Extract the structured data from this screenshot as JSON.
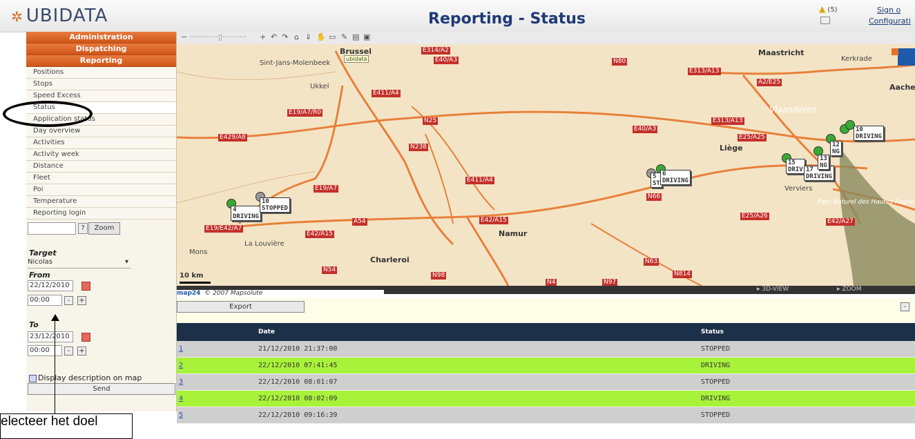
{
  "header": {
    "logo_text": "UBIDATA",
    "title": "Reporting - Status",
    "alert_count": "(5)",
    "sign_out": "Sign o",
    "configuration": "Configurati"
  },
  "sidebar": {
    "sections": [
      "Administration",
      "Dispatching",
      "Reporting"
    ],
    "items": [
      "Positions",
      "Stops",
      "Speed Excess",
      "Status",
      "Application status",
      "Day overview",
      "Activities",
      "Activity week",
      "Distance",
      "Fleet",
      "Poi",
      "Temperature",
      "Reporting login"
    ],
    "zoom_help": "?",
    "zoom_label": "Zoom",
    "target_label": "Target",
    "target_value": "Nicolas",
    "from_label": "From",
    "from_date": "22/12/2010",
    "from_time": "00:00",
    "to_label": "To",
    "to_date": "23/12/2010",
    "to_time": "00:00",
    "display_desc_label": "Display description on map",
    "send_label": "Send",
    "minus": "-",
    "plus": "+"
  },
  "map": {
    "places": [
      "Sint-Jans-Molenbeek",
      "Ukkel",
      "Maastricht",
      "Kerkrade",
      "Aachen",
      "Vlaanderen",
      "Liège",
      "Verviers",
      "Namur",
      "Charleroi",
      "La Louvière",
      "Mons",
      "Parc Naturel des Hautes Fagnes",
      "Brussel",
      "ubidata"
    ],
    "roads": [
      "E314/A2",
      "E40/A3",
      "N80",
      "E313/A13",
      "A2/E25",
      "E411/A4",
      "E19/A7/R0",
      "E429/A8",
      "N25",
      "N238",
      "E40/A3",
      "E313/A13",
      "E25/A25",
      "E19/A7",
      "E411/A4",
      "E42/A15",
      "A54",
      "E19/E42/A7",
      "E42/A15",
      "E25/A26",
      "E42/A27",
      "N63",
      "N54",
      "N98",
      "N4",
      "N97",
      "N814",
      "N66"
    ],
    "markers": [
      {
        "id": "4",
        "status": "DRIVING"
      },
      {
        "id": "10",
        "status": "STOPPED"
      },
      {
        "id": "5",
        "status": "ST"
      },
      {
        "id": "6",
        "status": "DRIVING"
      },
      {
        "id": "15",
        "status": "DRIV"
      },
      {
        "id": "17",
        "status": "DRIVING"
      },
      {
        "id": "13",
        "status": "NG"
      },
      {
        "id": "12",
        "status": "NG"
      },
      {
        "id": "10",
        "status": "DRIVING"
      }
    ],
    "scale": "10 km",
    "view_3d": "3D-VIEW",
    "zoom": "ZOOM",
    "copyright": "© 2007 Mapsolute",
    "brand": "map24"
  },
  "table": {
    "export_label": "Export",
    "headers": [
      "",
      "Date",
      "Status"
    ],
    "rows": [
      {
        "no": "1",
        "date": "21/12/2010 21:37:00",
        "status": "STOPPED"
      },
      {
        "no": "2",
        "date": "22/12/2010 07:41:45",
        "status": "DRIVING"
      },
      {
        "no": "3",
        "date": "22/12/2010 08:01:07",
        "status": "STOPPED"
      },
      {
        "no": "4",
        "date": "22/12/2010 08:02:09",
        "status": "DRIVING"
      },
      {
        "no": "5",
        "date": "22/12/2010 09:16:39",
        "status": "STOPPED"
      }
    ]
  },
  "annotation": {
    "text": "electeer het doel"
  },
  "colors": {
    "orange": "#d8621f",
    "navy": "#1d3049",
    "driving": "#a8f23a",
    "stopped": "#cfcfcf"
  }
}
